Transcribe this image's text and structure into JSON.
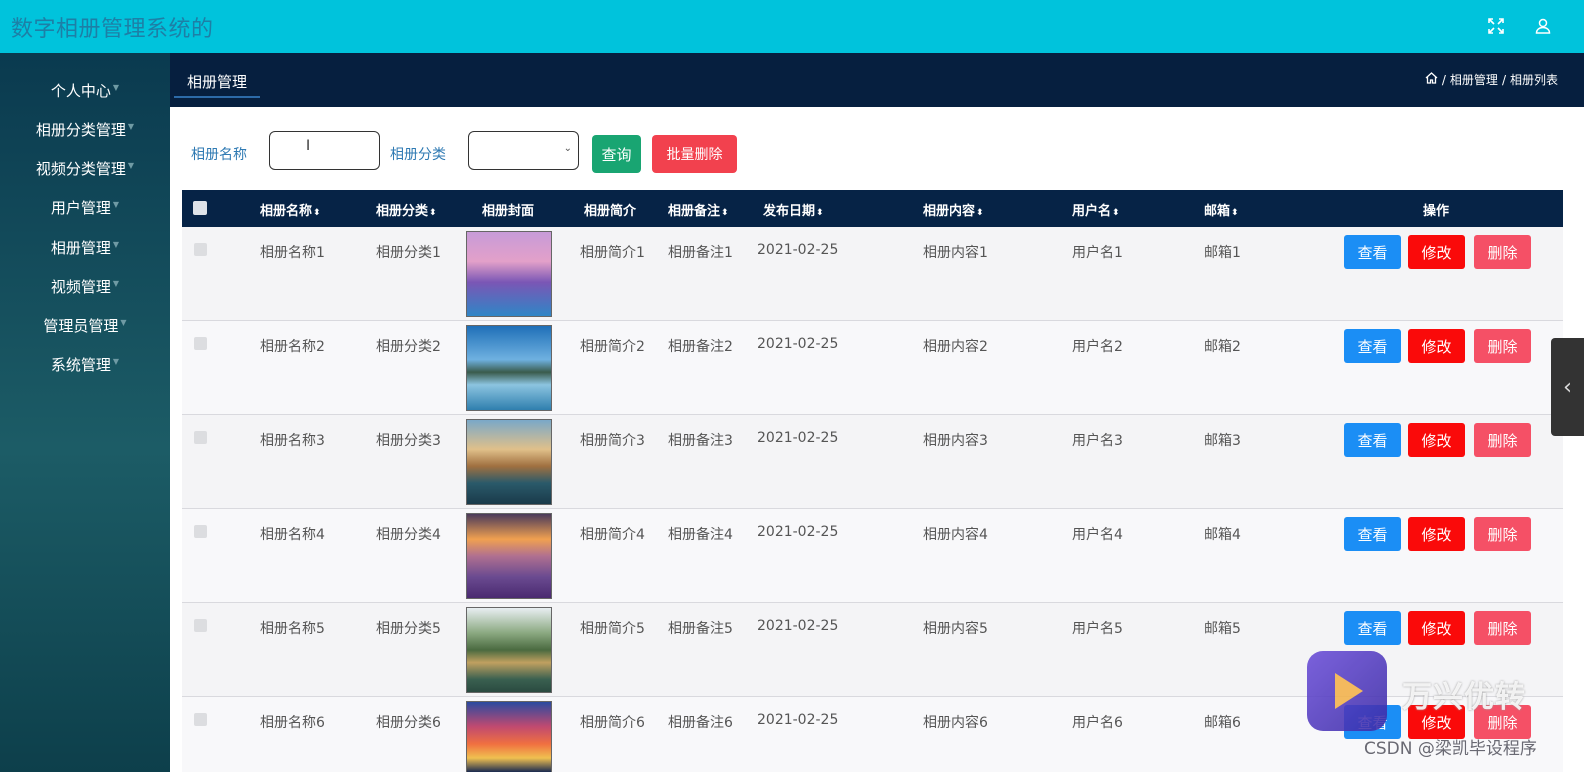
{
  "app": {
    "title": "数字相册管理系统的"
  },
  "topbar_icons": [
    "fullscreen-icon",
    "user-icon"
  ],
  "sidebar": {
    "items": [
      {
        "label": "个人中心"
      },
      {
        "label": "相册分类管理"
      },
      {
        "label": "视频分类管理"
      },
      {
        "label": "用户管理"
      },
      {
        "label": "相册管理"
      },
      {
        "label": "视频管理"
      },
      {
        "label": "管理员管理"
      },
      {
        "label": "系统管理"
      }
    ]
  },
  "tabbar": {
    "active_tab": "相册管理",
    "breadcrumb": [
      "相册管理",
      "相册列表"
    ]
  },
  "search": {
    "name_label": "相册名称",
    "name_value": "",
    "category_label": "相册分类",
    "category_value": "",
    "query_button": "查询",
    "batch_delete_button": "批量删除"
  },
  "table": {
    "columns": [
      "相册名称",
      "相册分类",
      "相册封面",
      "相册简介",
      "相册备注",
      "发布日期",
      "相册内容",
      "用户名",
      "邮箱",
      "操作"
    ],
    "sortable": [
      true,
      true,
      false,
      false,
      true,
      true,
      true,
      true,
      true,
      false
    ],
    "rows": [
      {
        "name": "相册名称1",
        "category": "相册分类1",
        "intro": "相册简介1",
        "remark": "相册备注1",
        "date": "2021-02-25",
        "content": "相册内容1",
        "user": "用户名1",
        "email": "邮箱1"
      },
      {
        "name": "相册名称2",
        "category": "相册分类2",
        "intro": "相册简介2",
        "remark": "相册备注2",
        "date": "2021-02-25",
        "content": "相册内容2",
        "user": "用户名2",
        "email": "邮箱2"
      },
      {
        "name": "相册名称3",
        "category": "相册分类3",
        "intro": "相册简介3",
        "remark": "相册备注3",
        "date": "2021-02-25",
        "content": "相册内容3",
        "user": "用户名3",
        "email": "邮箱3"
      },
      {
        "name": "相册名称4",
        "category": "相册分类4",
        "intro": "相册简介4",
        "remark": "相册备注4",
        "date": "2021-02-25",
        "content": "相册内容4",
        "user": "用户名4",
        "email": "邮箱4"
      },
      {
        "name": "相册名称5",
        "category": "相册分类5",
        "intro": "相册简介5",
        "remark": "相册备注5",
        "date": "2021-02-25",
        "content": "相册内容5",
        "user": "用户名5",
        "email": "邮箱5"
      },
      {
        "name": "相册名称6",
        "category": "相册分类6",
        "intro": "相册简介6",
        "remark": "相册备注6",
        "date": "2021-02-25",
        "content": "相册内容6",
        "user": "用户名6",
        "email": "邮箱6"
      }
    ],
    "actions": {
      "view": "查看",
      "edit": "修改",
      "delete": "删除"
    }
  },
  "watermark": {
    "brand": "万兴优转",
    "credit": "CSDN @梁凯毕设程序"
  },
  "colors": {
    "topbar": "#00c3dc",
    "tabbar": "#061f3f",
    "table_header": "#062346",
    "btn_view": "#1b8ef5",
    "btn_edit": "#fa0a0a",
    "btn_delete": "#f55066",
    "btn_query": "#19a572",
    "btn_batch_delete": "#f2414e"
  }
}
